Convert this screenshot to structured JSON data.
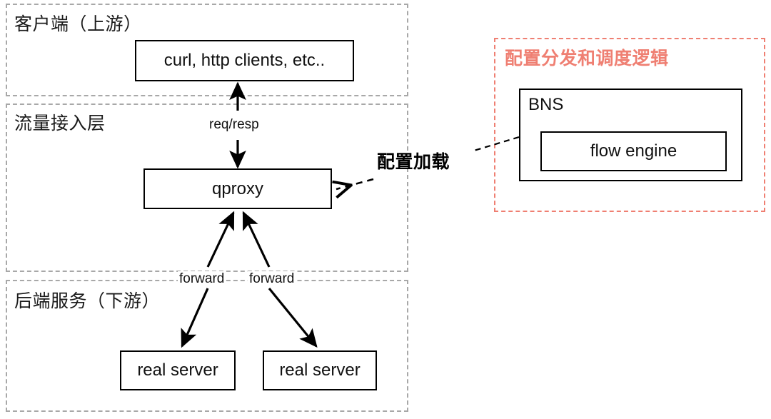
{
  "diagram": {
    "title_colors": {
      "red_accent": "#ef7f72",
      "dashed_gray": "#a8a8a8",
      "node_border": "#000000",
      "text": "#111111"
    },
    "zones": [
      {
        "id": "client",
        "label": "客户端（上游）"
      },
      {
        "id": "traffic",
        "label": "流量接入层"
      },
      {
        "id": "backend",
        "label": "后端服务（下游）"
      }
    ],
    "red_zone": {
      "label": "配置分发和调度逻辑"
    },
    "nodes": [
      {
        "id": "clients",
        "label": "curl, http clients, etc.."
      },
      {
        "id": "qproxy",
        "label": "qproxy"
      },
      {
        "id": "real_server_left",
        "label": "real server"
      },
      {
        "id": "real_server_right",
        "label": "real server"
      },
      {
        "id": "bns",
        "label": "BNS"
      },
      {
        "id": "flow_engine",
        "label": "flow engine"
      }
    ],
    "edge_labels": [
      {
        "id": "req_resp",
        "label": "req/resp"
      },
      {
        "id": "forward_left",
        "label": "forward"
      },
      {
        "id": "forward_right",
        "label": "forward"
      }
    ],
    "callouts": [
      {
        "id": "config_load",
        "label": "配置加载"
      }
    ]
  }
}
